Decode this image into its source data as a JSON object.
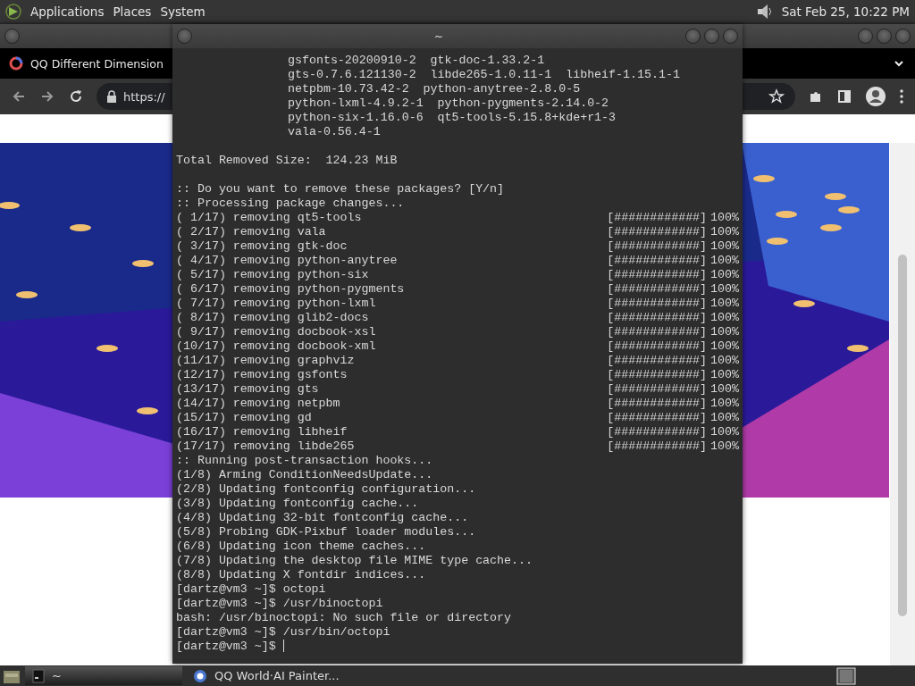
{
  "top_panel": {
    "menus": [
      "Applications",
      "Places",
      "System"
    ],
    "clock": "Sat Feb 25, 10:22 PM"
  },
  "browser": {
    "tab_title": "QQ Different Dimension",
    "address": "https://"
  },
  "terminal": {
    "title": "~",
    "lines": [
      {
        "kind": "indented",
        "text": "gsfonts-20200910-2  gtk-doc-1.33.2-1"
      },
      {
        "kind": "indented",
        "text": "gts-0.7.6.121130-2  libde265-1.0.11-1  libheif-1.15.1-1"
      },
      {
        "kind": "indented",
        "text": "netpbm-10.73.42-2  python-anytree-2.8.0-5"
      },
      {
        "kind": "indented",
        "text": "python-lxml-4.9.2-1  python-pygments-2.14.0-2"
      },
      {
        "kind": "indented",
        "text": "python-six-1.16.0-6  qt5-tools-5.15.8+kde+r1-3"
      },
      {
        "kind": "indented",
        "text": "vala-0.56.4-1"
      },
      {
        "kind": "blank"
      },
      {
        "kind": "text",
        "text": "Total Removed Size:  124.23 MiB"
      },
      {
        "kind": "blank"
      },
      {
        "kind": "text",
        "text": ":: Do you want to remove these packages? [Y/n]"
      },
      {
        "kind": "text",
        "text": ":: Processing package changes..."
      },
      {
        "kind": "progress",
        "text": "( 1/17) removing qt5-tools",
        "bar": "[############]",
        "percent": "100%"
      },
      {
        "kind": "progress",
        "text": "( 2/17) removing vala",
        "bar": "[############]",
        "percent": "100%"
      },
      {
        "kind": "progress",
        "text": "( 3/17) removing gtk-doc",
        "bar": "[############]",
        "percent": "100%"
      },
      {
        "kind": "progress",
        "text": "( 4/17) removing python-anytree",
        "bar": "[############]",
        "percent": "100%"
      },
      {
        "kind": "progress",
        "text": "( 5/17) removing python-six",
        "bar": "[############]",
        "percent": "100%"
      },
      {
        "kind": "progress",
        "text": "( 6/17) removing python-pygments",
        "bar": "[############]",
        "percent": "100%"
      },
      {
        "kind": "progress",
        "text": "( 7/17) removing python-lxml",
        "bar": "[############]",
        "percent": "100%"
      },
      {
        "kind": "progress",
        "text": "( 8/17) removing glib2-docs",
        "bar": "[############]",
        "percent": "100%"
      },
      {
        "kind": "progress",
        "text": "( 9/17) removing docbook-xsl",
        "bar": "[############]",
        "percent": "100%"
      },
      {
        "kind": "progress",
        "text": "(10/17) removing docbook-xml",
        "bar": "[############]",
        "percent": "100%"
      },
      {
        "kind": "progress",
        "text": "(11/17) removing graphviz",
        "bar": "[############]",
        "percent": "100%"
      },
      {
        "kind": "progress",
        "text": "(12/17) removing gsfonts",
        "bar": "[############]",
        "percent": "100%"
      },
      {
        "kind": "progress",
        "text": "(13/17) removing gts",
        "bar": "[############]",
        "percent": "100%"
      },
      {
        "kind": "progress",
        "text": "(14/17) removing netpbm",
        "bar": "[############]",
        "percent": "100%"
      },
      {
        "kind": "progress",
        "text": "(15/17) removing gd",
        "bar": "[############]",
        "percent": "100%"
      },
      {
        "kind": "progress",
        "text": "(16/17) removing libheif",
        "bar": "[############]",
        "percent": "100%"
      },
      {
        "kind": "progress",
        "text": "(17/17) removing libde265",
        "bar": "[############]",
        "percent": "100%"
      },
      {
        "kind": "text",
        "text": ":: Running post-transaction hooks..."
      },
      {
        "kind": "text",
        "text": "(1/8) Arming ConditionNeedsUpdate..."
      },
      {
        "kind": "text",
        "text": "(2/8) Updating fontconfig configuration..."
      },
      {
        "kind": "text",
        "text": "(3/8) Updating fontconfig cache..."
      },
      {
        "kind": "text",
        "text": "(4/8) Updating 32-bit fontconfig cache..."
      },
      {
        "kind": "text",
        "text": "(5/8) Probing GDK-Pixbuf loader modules..."
      },
      {
        "kind": "text",
        "text": "(6/8) Updating icon theme caches..."
      },
      {
        "kind": "text",
        "text": "(7/8) Updating the desktop file MIME type cache..."
      },
      {
        "kind": "text",
        "text": "(8/8) Updating X fontdir indices..."
      },
      {
        "kind": "text",
        "text": "[dartz@vm3 ~]$ octopi"
      },
      {
        "kind": "text",
        "text": "[dartz@vm3 ~]$ /usr/binoctopi"
      },
      {
        "kind": "text",
        "text": "bash: /usr/binoctopi: No such file or directory"
      },
      {
        "kind": "text",
        "text": "[dartz@vm3 ~]$ /usr/bin/octopi"
      },
      {
        "kind": "prompt",
        "text": "[dartz@vm3 ~]$"
      }
    ]
  },
  "taskbar": {
    "tasks": [
      {
        "kind": "terminal",
        "label": "~",
        "selected": true
      },
      {
        "kind": "browser",
        "label": "QQ World·AI Painter...",
        "selected": false
      }
    ]
  }
}
